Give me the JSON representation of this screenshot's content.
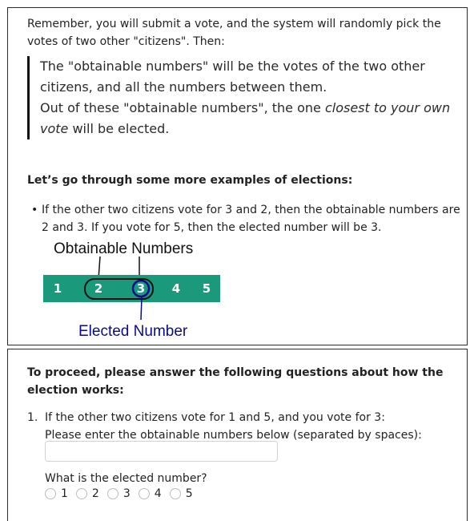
{
  "intro_text": "Remember, you will submit a vote, and the system will randomly pick the votes of two other \"citizens\". Then:",
  "rules": {
    "line1": "The \"obtainable numbers\" will be the votes of the two other citizens, and all the numbers between them.",
    "line2_before": "Out of these \"obtainable numbers\", the one ",
    "line2_emph": "closest to your own vote",
    "line2_after": " will be elected."
  },
  "examples": {
    "heading": "Let’s go through some more examples of elections:",
    "bullet_marker": "•",
    "example1": "If the other two citizens vote for 3 and 2, then the obtainable numbers are 2 and 3. If you vote for 5, then the elected number will be 3."
  },
  "diagram": {
    "obtainable_label": "Obtainable Numbers",
    "elected_label": "Elected Number",
    "numbers": [
      "1",
      "2",
      "3",
      "4",
      "5"
    ],
    "bar_color": "#1a9a7a",
    "elected_color": "#0a0a8a"
  },
  "questions": {
    "heading": "To proceed, please answer the following questions about how the election works:",
    "q1_number": "1.",
    "q1_line1": "If the other two citizens vote for 1 and 5, and you vote for 3:",
    "q1_line2": "Please enter the obtainable numbers below (separated by spaces):",
    "q1_input_value": "",
    "q1_input_placeholder": "",
    "elected_question": "What is the elected number?",
    "options": [
      "1",
      "2",
      "3",
      "4",
      "5"
    ]
  }
}
